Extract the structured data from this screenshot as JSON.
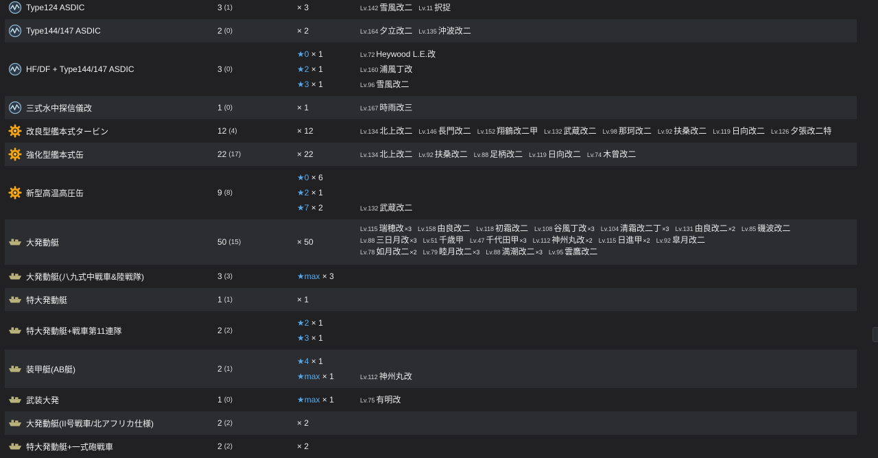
{
  "rows": [
    {
      "icon": "sonar-icon",
      "name": "Type124 ASDIC",
      "count": "3",
      "sub": "(1)",
      "h": 34,
      "stars": [
        {
          "star": "",
          "mult": "× 3"
        }
      ],
      "ships": [
        [
          {
            "lv": "Lv.142",
            "name": "雪風改二",
            "mult": ""
          },
          {
            "lv": "Lv.11",
            "name": "択捉",
            "mult": ""
          }
        ]
      ]
    },
    {
      "icon": "sonar-icon",
      "name": "Type144/147 ASDIC",
      "count": "2",
      "sub": "(0)",
      "h": 34,
      "stars": [
        {
          "star": "",
          "mult": "× 2"
        }
      ],
      "ships": [
        [
          {
            "lv": "Lv.164",
            "name": "夕立改二",
            "mult": ""
          },
          {
            "lv": "Lv.135",
            "name": "沖波改二",
            "mult": ""
          }
        ]
      ]
    },
    {
      "icon": "sonar-icon",
      "name": "HF/DF + Type144/147 ASDIC",
      "count": "3",
      "sub": "(0)",
      "h": 78,
      "stars": [
        {
          "star": "★0",
          "mult": "× 1"
        },
        {
          "star": "★2",
          "mult": "× 1"
        },
        {
          "star": "★3",
          "mult": "× 1"
        }
      ],
      "ships": [
        [
          {
            "lv": "Lv.72",
            "name": "Heywood L.E.改",
            "mult": ""
          }
        ],
        [
          {
            "lv": "Lv.160",
            "name": "浦風丁改",
            "mult": ""
          }
        ],
        [
          {
            "lv": "Lv.96",
            "name": "雪風改二",
            "mult": ""
          }
        ]
      ]
    },
    {
      "icon": "sonar-icon",
      "name": "三式水中探信儀改",
      "count": "1",
      "sub": "(0)",
      "h": 34,
      "stars": [
        {
          "star": "",
          "mult": "× 1"
        }
      ],
      "ships": [
        [
          {
            "lv": "Lv.167",
            "name": "時雨改三",
            "mult": ""
          }
        ]
      ]
    },
    {
      "icon": "turbine-icon",
      "name": "改良型艦本式タービン",
      "count": "12",
      "sub": "(4)",
      "h": 34,
      "stars": [
        {
          "star": "",
          "mult": "× 12"
        }
      ],
      "ships": [
        [
          {
            "lv": "Lv.134",
            "name": "北上改二",
            "mult": ""
          },
          {
            "lv": "Lv.146",
            "name": "長門改二",
            "mult": ""
          },
          {
            "lv": "Lv.152",
            "name": "翔鶴改二甲",
            "mult": ""
          },
          {
            "lv": "Lv.132",
            "name": "武蔵改二",
            "mult": ""
          },
          {
            "lv": "Lv.98",
            "name": "那珂改二",
            "mult": ""
          },
          {
            "lv": "Lv.92",
            "name": "扶桑改二",
            "mult": ""
          },
          {
            "lv": "Lv.119",
            "name": "日向改二",
            "mult": ""
          },
          {
            "lv": "Lv.126",
            "name": "夕張改二特",
            "mult": ""
          }
        ]
      ]
    },
    {
      "icon": "turbine-icon",
      "name": "強化型艦本式缶",
      "count": "22",
      "sub": "(17)",
      "h": 34,
      "stars": [
        {
          "star": "",
          "mult": "× 22"
        }
      ],
      "ships": [
        [
          {
            "lv": "Lv.134",
            "name": "北上改二",
            "mult": ""
          },
          {
            "lv": "Lv.92",
            "name": "扶桑改二",
            "mult": ""
          },
          {
            "lv": "Lv.88",
            "name": "足柄改二",
            "mult": ""
          },
          {
            "lv": "Lv.119",
            "name": "日向改二",
            "mult": ""
          },
          {
            "lv": "Lv.74",
            "name": "木曾改二",
            "mult": ""
          }
        ]
      ]
    },
    {
      "icon": "turbine-icon",
      "name": "新型高温高圧缶",
      "count": "9",
      "sub": "(8)",
      "h": 78,
      "stars": [
        {
          "star": "★0",
          "mult": "× 6"
        },
        {
          "star": "★2",
          "mult": "× 1"
        },
        {
          "star": "★7",
          "mult": "× 2"
        }
      ],
      "ships": [
        [],
        [],
        [
          {
            "lv": "Lv.132",
            "name": "武蔵改二",
            "mult": ""
          }
        ]
      ]
    },
    {
      "icon": "landing-craft-icon",
      "name": "大発動艇",
      "count": "50",
      "sub": "(15)",
      "h": 66,
      "wrap": true,
      "stars": [
        {
          "star": "",
          "mult": "× 50"
        }
      ],
      "ships": [
        [
          {
            "lv": "Lv.115",
            "name": "瑞穂改",
            "mult": "×3"
          },
          {
            "lv": "Lv.158",
            "name": "由良改二",
            "mult": ""
          },
          {
            "lv": "Lv.118",
            "name": "初霜改二",
            "mult": ""
          },
          {
            "lv": "Lv.108",
            "name": "谷風丁改",
            "mult": "×3"
          },
          {
            "lv": "Lv.104",
            "name": "清霜改二丁",
            "mult": "×3"
          },
          {
            "lv": "Lv.131",
            "name": "由良改二",
            "mult": "×2"
          },
          {
            "lv": "Lv.85",
            "name": "磯波改二",
            "mult": ""
          },
          {
            "lv": "Lv.88",
            "name": "三日月改",
            "mult": "×3"
          },
          {
            "lv": "Lv.51",
            "name": "千歳甲",
            "mult": ""
          },
          {
            "lv": "Lv.47",
            "name": "千代田甲",
            "mult": "×3"
          },
          {
            "lv": "Lv.112",
            "name": "神州丸改",
            "mult": "×2"
          },
          {
            "lv": "Lv.115",
            "name": "日進甲",
            "mult": "×2"
          },
          {
            "lv": "Lv.92",
            "name": "皐月改二",
            "mult": ""
          },
          {
            "lv": "Lv.78",
            "name": "如月改二",
            "mult": "×2"
          },
          {
            "lv": "Lv.79",
            "name": "睦月改二",
            "mult": "×3"
          },
          {
            "lv": "Lv.88",
            "name": "満潮改二",
            "mult": "×3"
          },
          {
            "lv": "Lv.95",
            "name": "雲鷹改二",
            "mult": ""
          }
        ]
      ]
    },
    {
      "icon": "landing-craft-icon",
      "name": "大発動艇(八九式中戦車&陸戦隊)",
      "count": "3",
      "sub": "(3)",
      "h": 34,
      "stars": [
        {
          "star": "★max",
          "mult": "× 3"
        }
      ],
      "ships": [
        []
      ]
    },
    {
      "icon": "landing-craft-icon",
      "name": "特大発動艇",
      "count": "1",
      "sub": "(1)",
      "h": 34,
      "stars": [
        {
          "star": "",
          "mult": "× 1"
        }
      ],
      "ships": [
        []
      ]
    },
    {
      "icon": "landing-craft-icon",
      "name": "特大発動艇+戦車第11連隊",
      "count": "2",
      "sub": "(2)",
      "h": 56,
      "stars": [
        {
          "star": "★2",
          "mult": "× 1"
        },
        {
          "star": "★3",
          "mult": "× 1"
        }
      ],
      "ships": [
        [],
        []
      ]
    },
    {
      "icon": "landing-craft-icon",
      "name": "装甲艇(AB艇)",
      "count": "2",
      "sub": "(1)",
      "h": 56,
      "stars": [
        {
          "star": "★4",
          "mult": "× 1"
        },
        {
          "star": "★max",
          "mult": "× 1"
        }
      ],
      "ships": [
        [],
        [
          {
            "lv": "Lv.112",
            "name": "神州丸改",
            "mult": ""
          }
        ]
      ]
    },
    {
      "icon": "landing-craft-icon",
      "name": "武装大発",
      "count": "1",
      "sub": "(0)",
      "h": 34,
      "stars": [
        {
          "star": "★max",
          "mult": "× 1"
        }
      ],
      "ships": [
        [
          {
            "lv": "Lv.75",
            "name": "有明改",
            "mult": ""
          }
        ]
      ]
    },
    {
      "icon": "landing-craft-icon",
      "name": "大発動艇(II号戦車/北アフリカ仕様)",
      "count": "2",
      "sub": "(2)",
      "h": 34,
      "stars": [
        {
          "star": "",
          "mult": "× 2"
        }
      ],
      "ships": [
        []
      ]
    },
    {
      "icon": "landing-craft-icon",
      "name": "特大発動艇+一式砲戦車",
      "count": "2",
      "sub": "(2)",
      "h": 34,
      "stars": [
        {
          "star": "",
          "mult": "× 2"
        }
      ],
      "ships": [
        []
      ]
    }
  ]
}
